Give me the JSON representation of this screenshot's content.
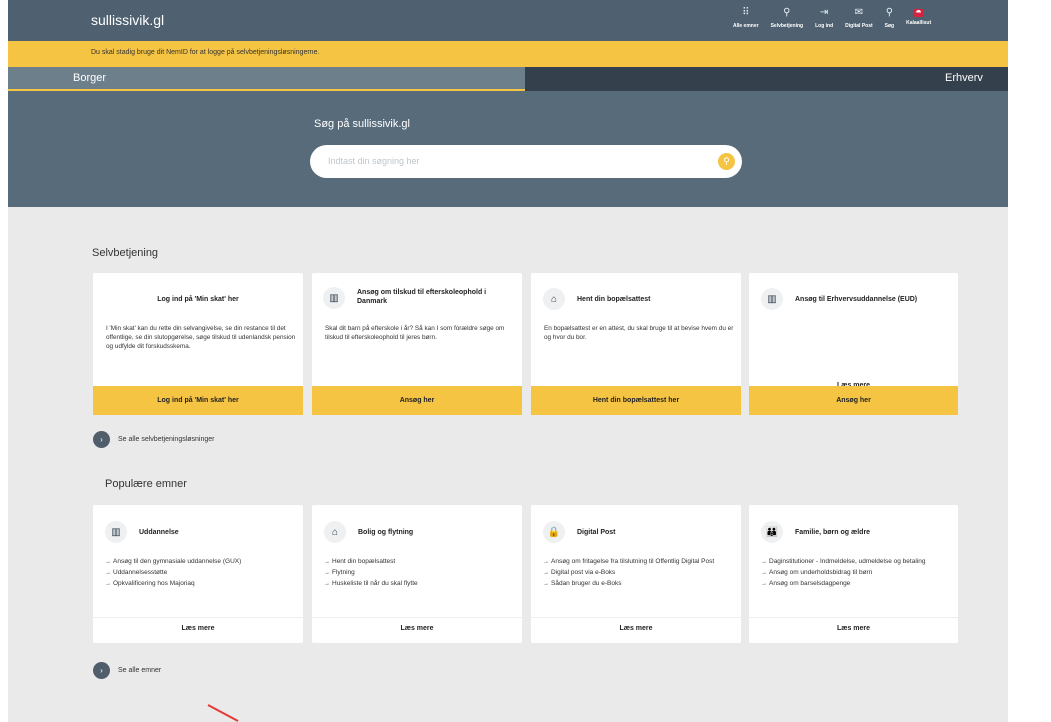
{
  "header": {
    "logo": "sullissivik.gl",
    "nav": [
      {
        "label": "Alle emner",
        "icon": "grid-icon"
      },
      {
        "label": "Selvbetjening",
        "icon": "selfservice-icon"
      },
      {
        "label": "Log ind",
        "icon": "login-icon"
      },
      {
        "label": "Digital Post",
        "icon": "mail-icon"
      },
      {
        "label": "Søg",
        "icon": "search-icon"
      },
      {
        "label": "Kalaallisut",
        "icon": "flag-icon"
      }
    ]
  },
  "notice": "Du skal stadig bruge dit NemID for at logge på selvbetjeningsløsningerne.",
  "tabs": {
    "borger": "Borger",
    "erhverv": "Erhverv"
  },
  "hero": {
    "title": "Søg på sullissivik.gl",
    "search_placeholder": "Indtast din søgning her"
  },
  "selvbetjening": {
    "title": "Selvbetjening",
    "cards": [
      {
        "title": "Log ind på 'Min skat' her",
        "body": "I 'Min skat' kan du rette din selvangivelse, se din restance til det offentlige, se din slutopgørelse, søge tilskud til udenlandsk pension og udfylde dit forskudsskema.",
        "button": "Log ind på 'Min skat' her"
      },
      {
        "title": "Ansøg om tilskud til efterskoleophold i Danmark",
        "body": "Skal dit barn på efterskole i år? Så kan I som forældre søge om tilskud til efterskoleophold til jeres børn.",
        "button": "Ansøg her"
      },
      {
        "title": "Hent din bopælsattest",
        "body": "En bopælsattest er en attest, du skal bruge til at bevise hvem du er og hvor du bor.",
        "button": "Hent din bopælsattest her"
      },
      {
        "title": "Ansøg til Erhvervsuddannelse (EUD)",
        "body": "",
        "link": "Læs mere",
        "button": "Ansøg her"
      }
    ],
    "see_all": "Se alle selvbetjeningsløsninger"
  },
  "populaere": {
    "title": "Populære emner",
    "cards": [
      {
        "title": "Uddannelse",
        "items": [
          "Ansøg til den gymnasiale uddannelse (GUX)",
          "Uddannelsesstøtte",
          "Opkvalificering hos Majoriaq"
        ],
        "link": "Læs mere"
      },
      {
        "title": "Bolig og flytning",
        "items": [
          "Hent din bopælsattest",
          "Flytning",
          "Huskeliste til når du skal flytte"
        ],
        "link": "Læs mere"
      },
      {
        "title": "Digital Post",
        "items": [
          "Ansøg om fritagelse fra tilslutning til Offentlig Digital Post",
          "Digital post via e-Boks",
          "Sådan bruger du e-Boks"
        ],
        "link": "Læs mere"
      },
      {
        "title": "Familie, børn og ældre",
        "items": [
          "Daginstitutioner - Indmeldelse, udmeldelse og betaling",
          "Ansøg om underholdsbidrag til børn",
          "Ansøg om barselsdagpenge"
        ],
        "link": "Læs mere"
      }
    ],
    "see_all": "Se alle emner"
  },
  "colors": {
    "accent": "#f6c443",
    "header": "#4f6170",
    "hero": "#576b7b",
    "dark_tab": "#34414c"
  }
}
